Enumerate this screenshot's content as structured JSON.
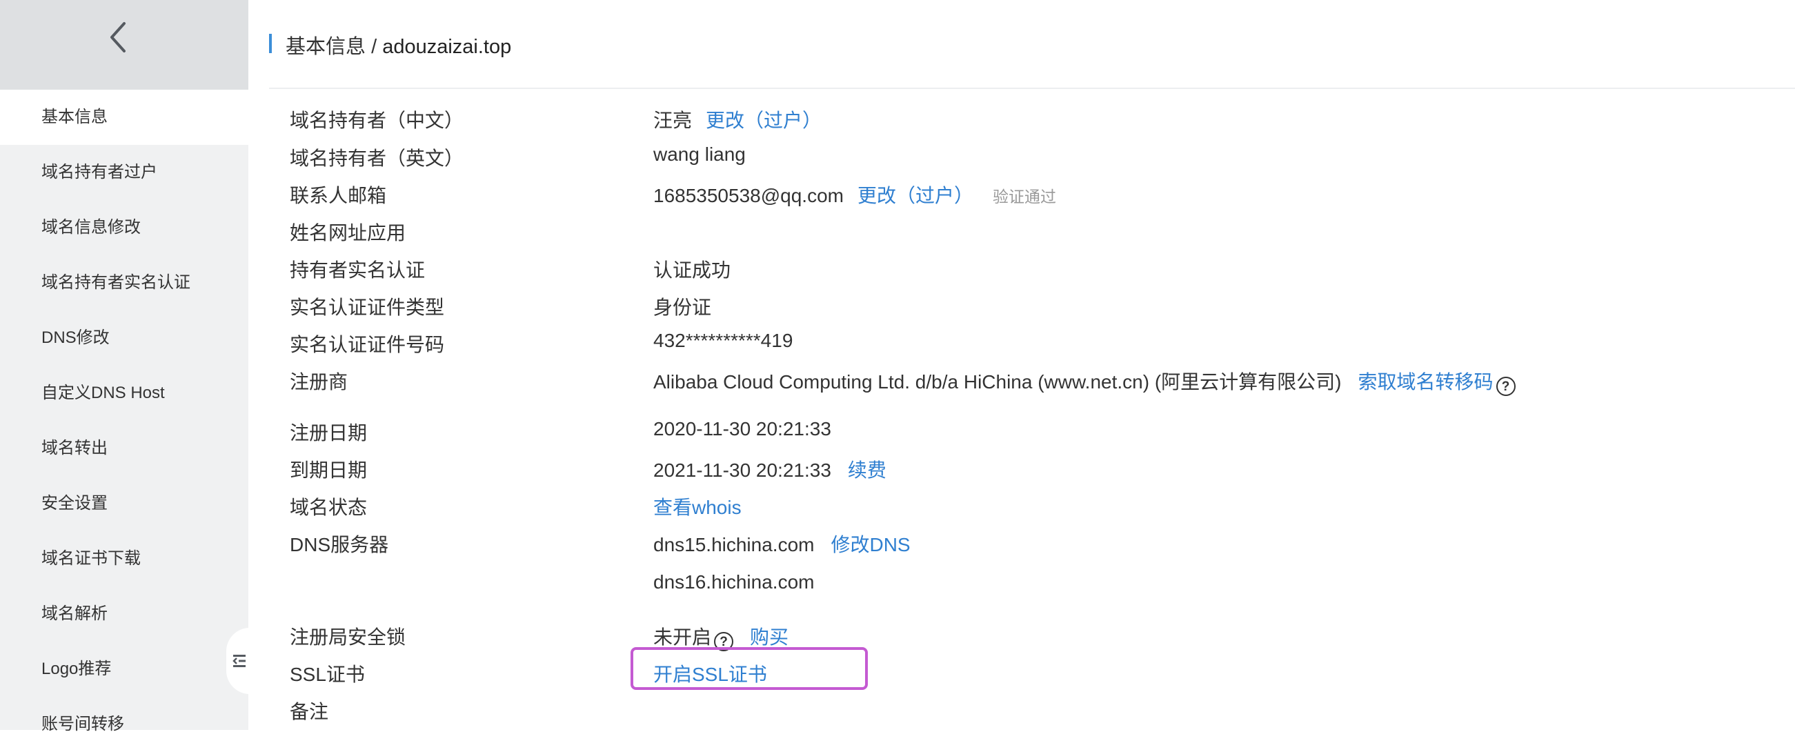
{
  "sidebar": {
    "items": [
      {
        "label": "基本信息"
      },
      {
        "label": "域名持有者过户"
      },
      {
        "label": "域名信息修改"
      },
      {
        "label": "域名持有者实名认证"
      },
      {
        "label": "DNS修改"
      },
      {
        "label": "自定义DNS Host"
      },
      {
        "label": "域名转出"
      },
      {
        "label": "安全设置"
      },
      {
        "label": "域名证书下载"
      },
      {
        "label": "域名解析"
      },
      {
        "label": "Logo推荐"
      },
      {
        "label": "账号间转移"
      }
    ],
    "active_index": 0
  },
  "header": {
    "section": "基本信息",
    "separator": " / ",
    "domain": "adouzaizai.top"
  },
  "info": {
    "owner_cn": {
      "label": "域名持有者（中文）",
      "value": "汪亮",
      "action": "更改（过户）"
    },
    "owner_en": {
      "label": "域名持有者（英文）",
      "value": "wang liang"
    },
    "email": {
      "label": "联系人邮箱",
      "value": "1685350538@qq.com",
      "action": "更改（过户）",
      "status": "验证通过"
    },
    "personal_url": {
      "label": "姓名网址应用"
    },
    "realname": {
      "label": "持有者实名认证",
      "value": "认证成功"
    },
    "id_type": {
      "label": "实名认证证件类型",
      "value": "身份证"
    },
    "id_number": {
      "label": "实名认证证件号码",
      "value": "432**********419"
    },
    "registrar": {
      "label": "注册商",
      "value": "Alibaba Cloud Computing Ltd. d/b/a HiChina (www.net.cn) (阿里云计算有限公司)",
      "action": "索取域名转移码"
    },
    "reg_date": {
      "label": "注册日期",
      "value": "2020-11-30 20:21:33"
    },
    "exp_date": {
      "label": "到期日期",
      "value": "2021-11-30 20:21:33",
      "action": "续费"
    },
    "status": {
      "label": "域名状态",
      "action": "查看whois"
    },
    "dns": {
      "label": "DNS服务器",
      "servers": [
        "dns15.hichina.com",
        "dns16.hichina.com"
      ],
      "action": "修改DNS"
    },
    "registry_lock": {
      "label": "注册局安全锁",
      "value": "未开启",
      "action": "购买"
    },
    "ssl": {
      "label": "SSL证书",
      "action": "开启SSL证书"
    },
    "remark": {
      "label": "备注"
    }
  },
  "icons": {
    "back": "chevron-left-icon",
    "help": "question-circle-icon",
    "collapse": "collapse-sidebar-icon"
  },
  "colors": {
    "link": "#2f7fd0",
    "accent_bar": "#3c8ed8",
    "highlight": "#c45ad2",
    "sidebar_bg": "#f0f1f2"
  }
}
